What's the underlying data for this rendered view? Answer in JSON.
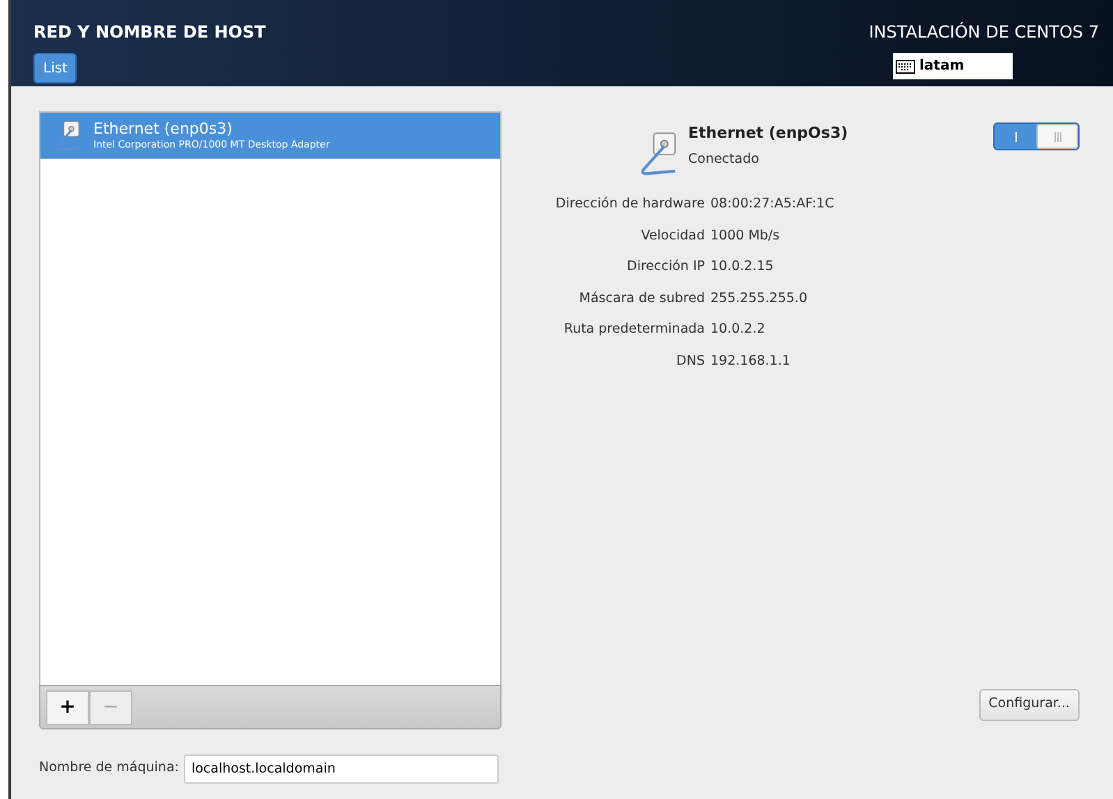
{
  "header": {
    "title": "RED Y NOMBRE DE HOST",
    "done_button": "List",
    "product": "INSTALACIÓN DE CENTOS 7",
    "keyboard_layout": "latam"
  },
  "devices": [
    {
      "name": "Ethernet (enp0s3)",
      "description": "Intel Corporation PRO/1000 MT Desktop Adapter",
      "selected": true
    }
  ],
  "list_toolbar": [
    {
      "label": "+",
      "disabled": false
    },
    {
      "label": "−",
      "disabled": true
    }
  ],
  "hostname": {
    "label": "Nombre de máquina:",
    "value": "localhost.localdomain"
  },
  "detail": {
    "name": "Ethernet (enpOs3)",
    "status": "Conectado",
    "on": true,
    "properties": [
      {
        "label": "Dirección de hardware",
        "value": "08:00:27:A5:AF:1C"
      },
      {
        "label": "Velocidad",
        "value": "1000 Mb/s"
      },
      {
        "label": "Dirección IP",
        "value": "10.0.2.15"
      },
      {
        "label": "Máscara de subred",
        "value": "255.255.255.0"
      },
      {
        "label": "Ruta predeterminada",
        "value": "10.0.2.2"
      },
      {
        "label": "DNS",
        "value": "192.168.1.1"
      }
    ],
    "configure_button": "Configurar..."
  }
}
